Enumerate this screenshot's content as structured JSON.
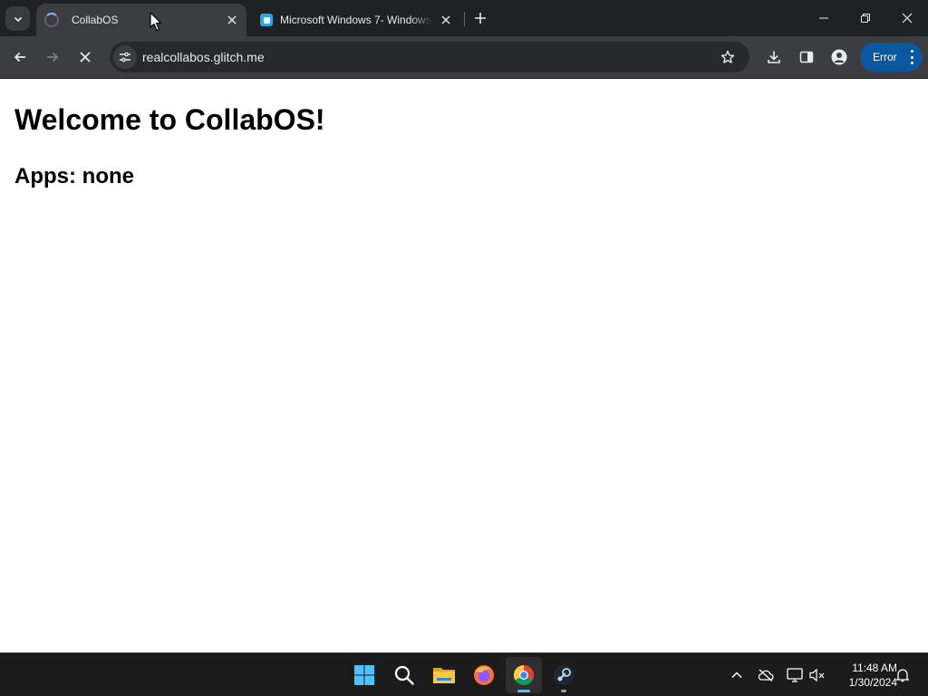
{
  "browser": {
    "tabs": [
      {
        "title": "CollabOS",
        "active": true,
        "loading": true
      },
      {
        "title": "Microsoft Windows 7- Windows",
        "active": false
      }
    ],
    "address": "realcollabos.glitch.me",
    "profile_status": "Error"
  },
  "page": {
    "heading": "Welcome to CollabOS!",
    "apps_line": "Apps: none"
  },
  "taskbar": {
    "pinned": [
      "start-icon",
      "search-icon",
      "file-explorer-icon",
      "firefox-icon",
      "chrome-icon",
      "steam-icon"
    ],
    "clock": {
      "time": "11:48 AM",
      "date": "1/30/2024"
    }
  },
  "colors": {
    "tabstrip": "#202124",
    "toolbar": "#3c3d41",
    "omnibox": "#28292c",
    "error_pill": "#0b57a0",
    "taskbar": "#1c1c1c",
    "accent": "#4cc2ff"
  }
}
